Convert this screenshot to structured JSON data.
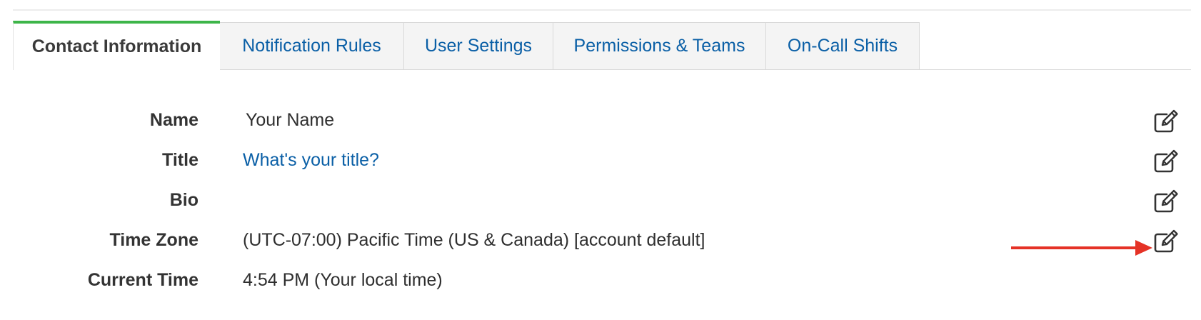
{
  "tabs": [
    {
      "label": "Contact Information",
      "active": true
    },
    {
      "label": "Notification Rules",
      "active": false
    },
    {
      "label": "User Settings",
      "active": false
    },
    {
      "label": "Permissions & Teams",
      "active": false
    },
    {
      "label": "On-Call Shifts",
      "active": false
    }
  ],
  "fields": {
    "name": {
      "label": "Name",
      "value": "Your Name"
    },
    "title": {
      "label": "Title",
      "value": "What's your title?"
    },
    "bio": {
      "label": "Bio",
      "value": ""
    },
    "time_zone": {
      "label": "Time Zone",
      "value": "(UTC-07:00) Pacific Time (US & Canada) [account default]"
    },
    "current_time": {
      "label": "Current Time",
      "value": "4:54 PM (Your local time)"
    }
  },
  "icons": {
    "edit": "edit-icon",
    "annotation": "red-arrow"
  },
  "colors": {
    "active_tab_accent": "#3db549",
    "link": "#0a5fa6",
    "annotation_arrow": "#e53226"
  }
}
